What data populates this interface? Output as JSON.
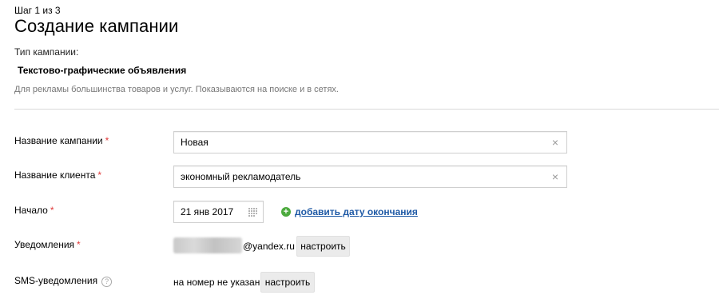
{
  "header": {
    "step": "Шаг 1 из 3",
    "title": "Создание кампании"
  },
  "campaign_type": {
    "label": "Тип кампании:",
    "name": "Текстово-графические объявления",
    "description": "Для рекламы большинства товаров и услуг. Показываются на поиске и в сетях."
  },
  "form": {
    "required_mark": "*",
    "campaign_name": {
      "label": "Название кампании",
      "value": "Новая"
    },
    "client_name": {
      "label": "Название клиента",
      "value": "экономный рекламодатель"
    },
    "start": {
      "label": "Начало",
      "value": "21 янв 2017",
      "add_end_date": "добавить дату окончания"
    },
    "notifications": {
      "label": "Уведомления",
      "email_domain": "@yandex.ru",
      "configure": "настроить"
    },
    "sms": {
      "label": "SMS-уведомления",
      "help": "?",
      "status": "на номер не указан",
      "configure": "настроить"
    }
  },
  "icons": {
    "clear": "close-icon",
    "calendar": "calendar-icon",
    "add": "plus-circle-icon",
    "help": "help-icon"
  },
  "colors": {
    "required": "#e03a3a",
    "link": "#1f5aa6",
    "add_icon": "#4caa3e",
    "button_bg": "#ebebeb"
  }
}
